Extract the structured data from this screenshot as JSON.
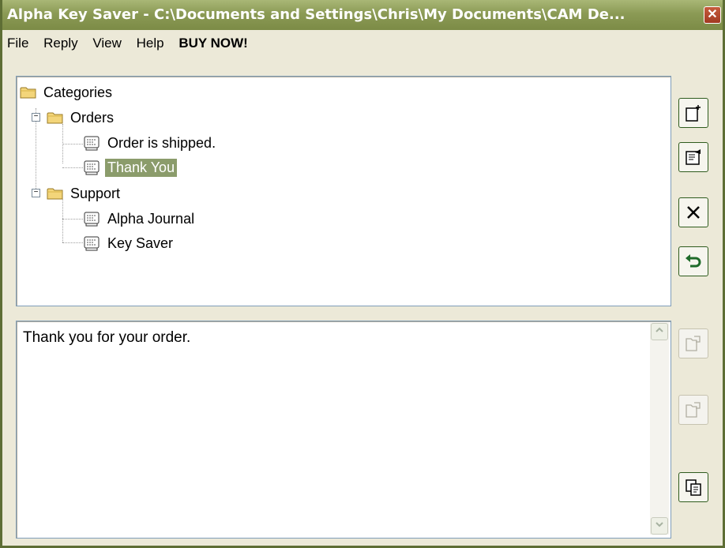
{
  "window": {
    "title": "Alpha Key Saver - C:\\Documents and Settings\\Chris\\My Documents\\CAM De...",
    "close_symbol": "✕"
  },
  "menu": {
    "items": [
      "File",
      "Reply",
      "View",
      "Help"
    ],
    "buy_now": "BUY NOW!"
  },
  "tree": {
    "root": "Categories",
    "orders": {
      "label": "Orders",
      "children": [
        "Order is shipped.",
        "Thank You"
      ]
    },
    "support": {
      "label": "Support",
      "children": [
        "Alpha Journal",
        "Key Saver"
      ]
    },
    "selected": "Thank You"
  },
  "message": {
    "text": "Thank you for your order."
  },
  "toolbar": {
    "icons": [
      "new-document-icon",
      "edit-properties-icon",
      "delete-icon",
      "undo-icon"
    ],
    "lower_icons": [
      "paste-icon",
      "paste-icon",
      "copy-icon"
    ]
  },
  "colors": {
    "titlebar": "#8b9a55",
    "selection": "#8b9c6b",
    "accent_border": "#2f5c1e"
  }
}
